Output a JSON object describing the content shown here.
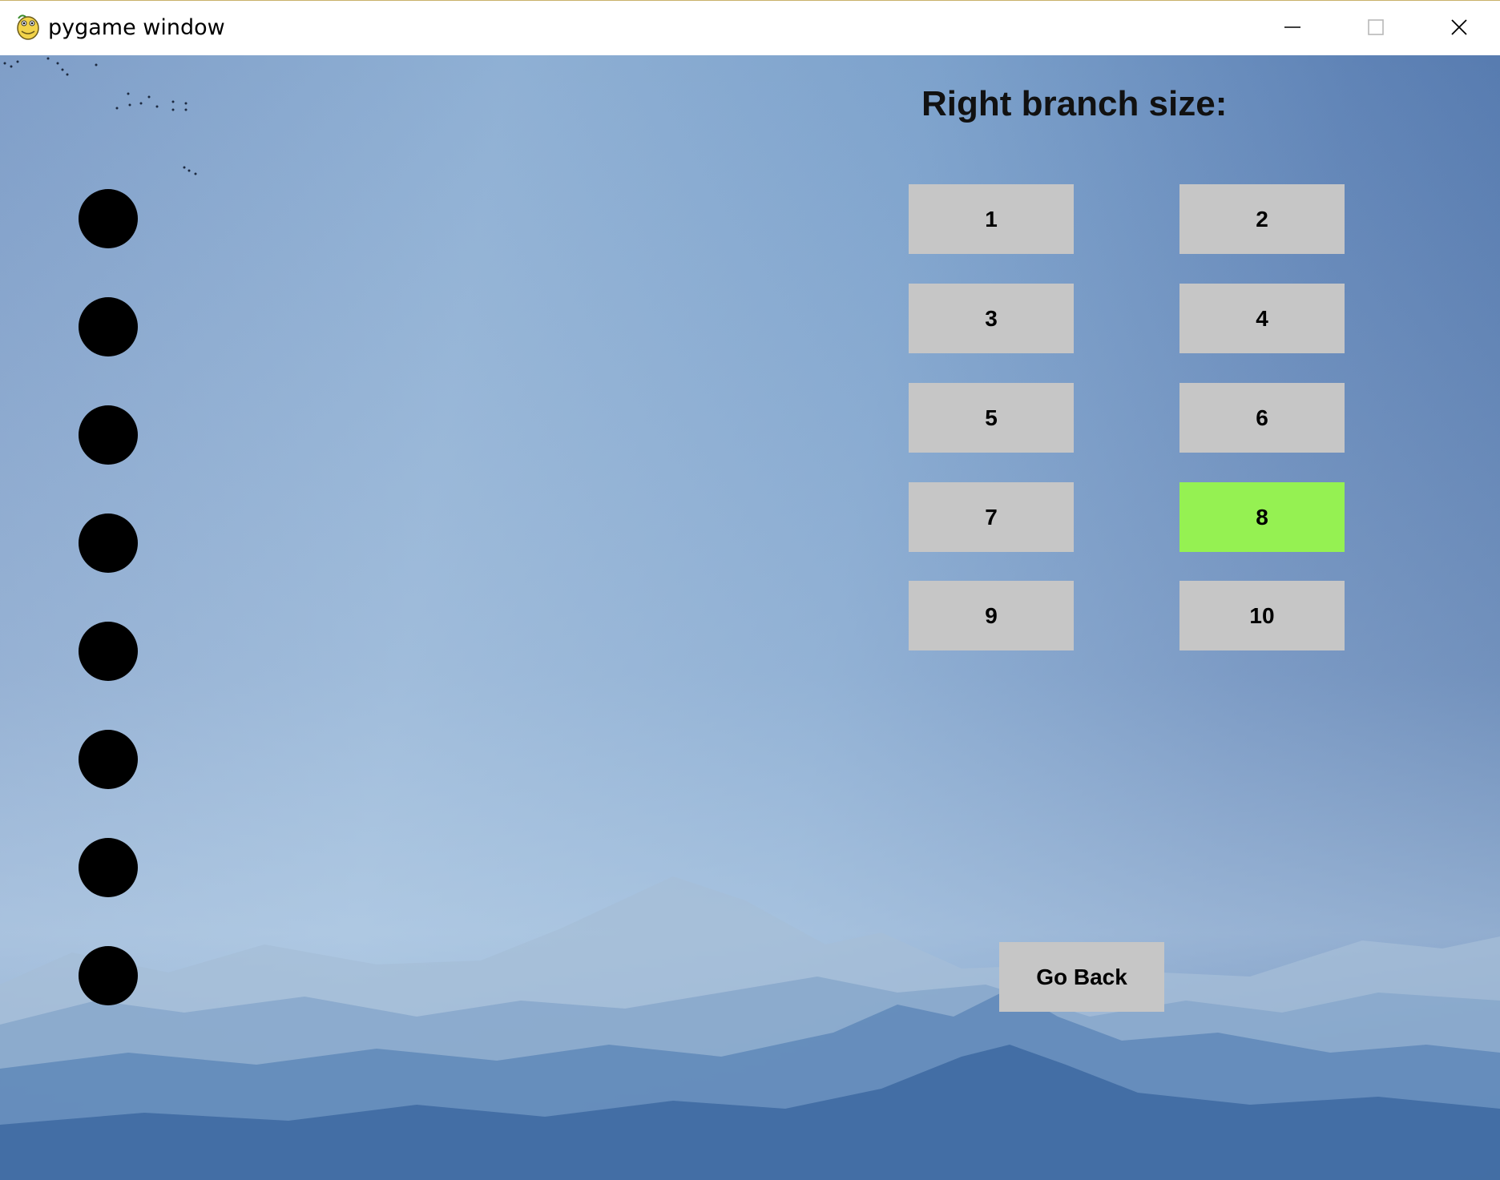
{
  "window": {
    "title": "pygame window",
    "app_icon": "pygame-snake-icon",
    "controls": [
      "minimize-icon",
      "maximize-icon",
      "close-icon"
    ]
  },
  "screen": {
    "heading": "Right branch size:",
    "size_options": [
      {
        "label": "1",
        "selected": false
      },
      {
        "label": "2",
        "selected": false
      },
      {
        "label": "3",
        "selected": false
      },
      {
        "label": "4",
        "selected": false
      },
      {
        "label": "5",
        "selected": false
      },
      {
        "label": "6",
        "selected": false
      },
      {
        "label": "7",
        "selected": false
      },
      {
        "label": "8",
        "selected": true
      },
      {
        "label": "9",
        "selected": false
      },
      {
        "label": "10",
        "selected": false
      }
    ],
    "selected_value": "8",
    "back_button": "Go Back",
    "branch_dot_count": 8
  },
  "colors": {
    "button_bg": "#c6c6c6",
    "selected_bg": "#95f152",
    "dot": "#000000",
    "text": "#111111"
  }
}
